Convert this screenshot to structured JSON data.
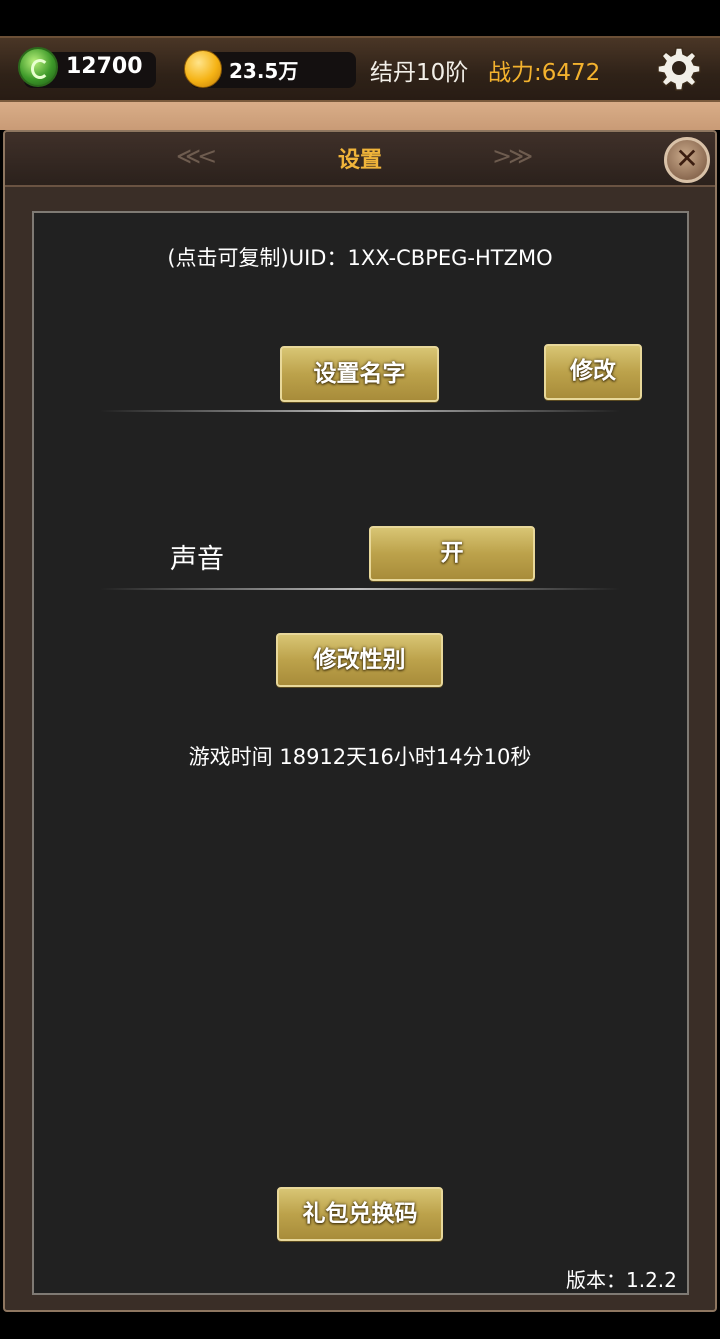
{
  "topbar": {
    "jade_value": "12700",
    "gold_value": "23.5万",
    "realm": "结丹10阶",
    "power": "战力:6472",
    "jade_icon": "jade-icon",
    "coin_icon": "gold-coin-icon",
    "settings_icon": "gear-icon"
  },
  "dialog": {
    "title": "设置",
    "deco_left": "≪<",
    "deco_right": ">≫",
    "close_glyph": "✕",
    "uid_text": "(点击可复制)UID：1XX-CBPEG-HTZMO",
    "set_name_label": "设置名字",
    "modify_label": "修改",
    "sound_label": "声音",
    "sound_state": "开",
    "change_gender_label": "修改性别",
    "play_time": "游戏时间 18912天16小时14分10秒",
    "gift_code_label": "礼包兑换码",
    "version": "版本：1.2.2"
  },
  "colors": {
    "accent_gold": "#f0b43a",
    "power_orange": "#f3b22e",
    "button_gold": "#bca24b",
    "panel_bg": "#212121"
  }
}
